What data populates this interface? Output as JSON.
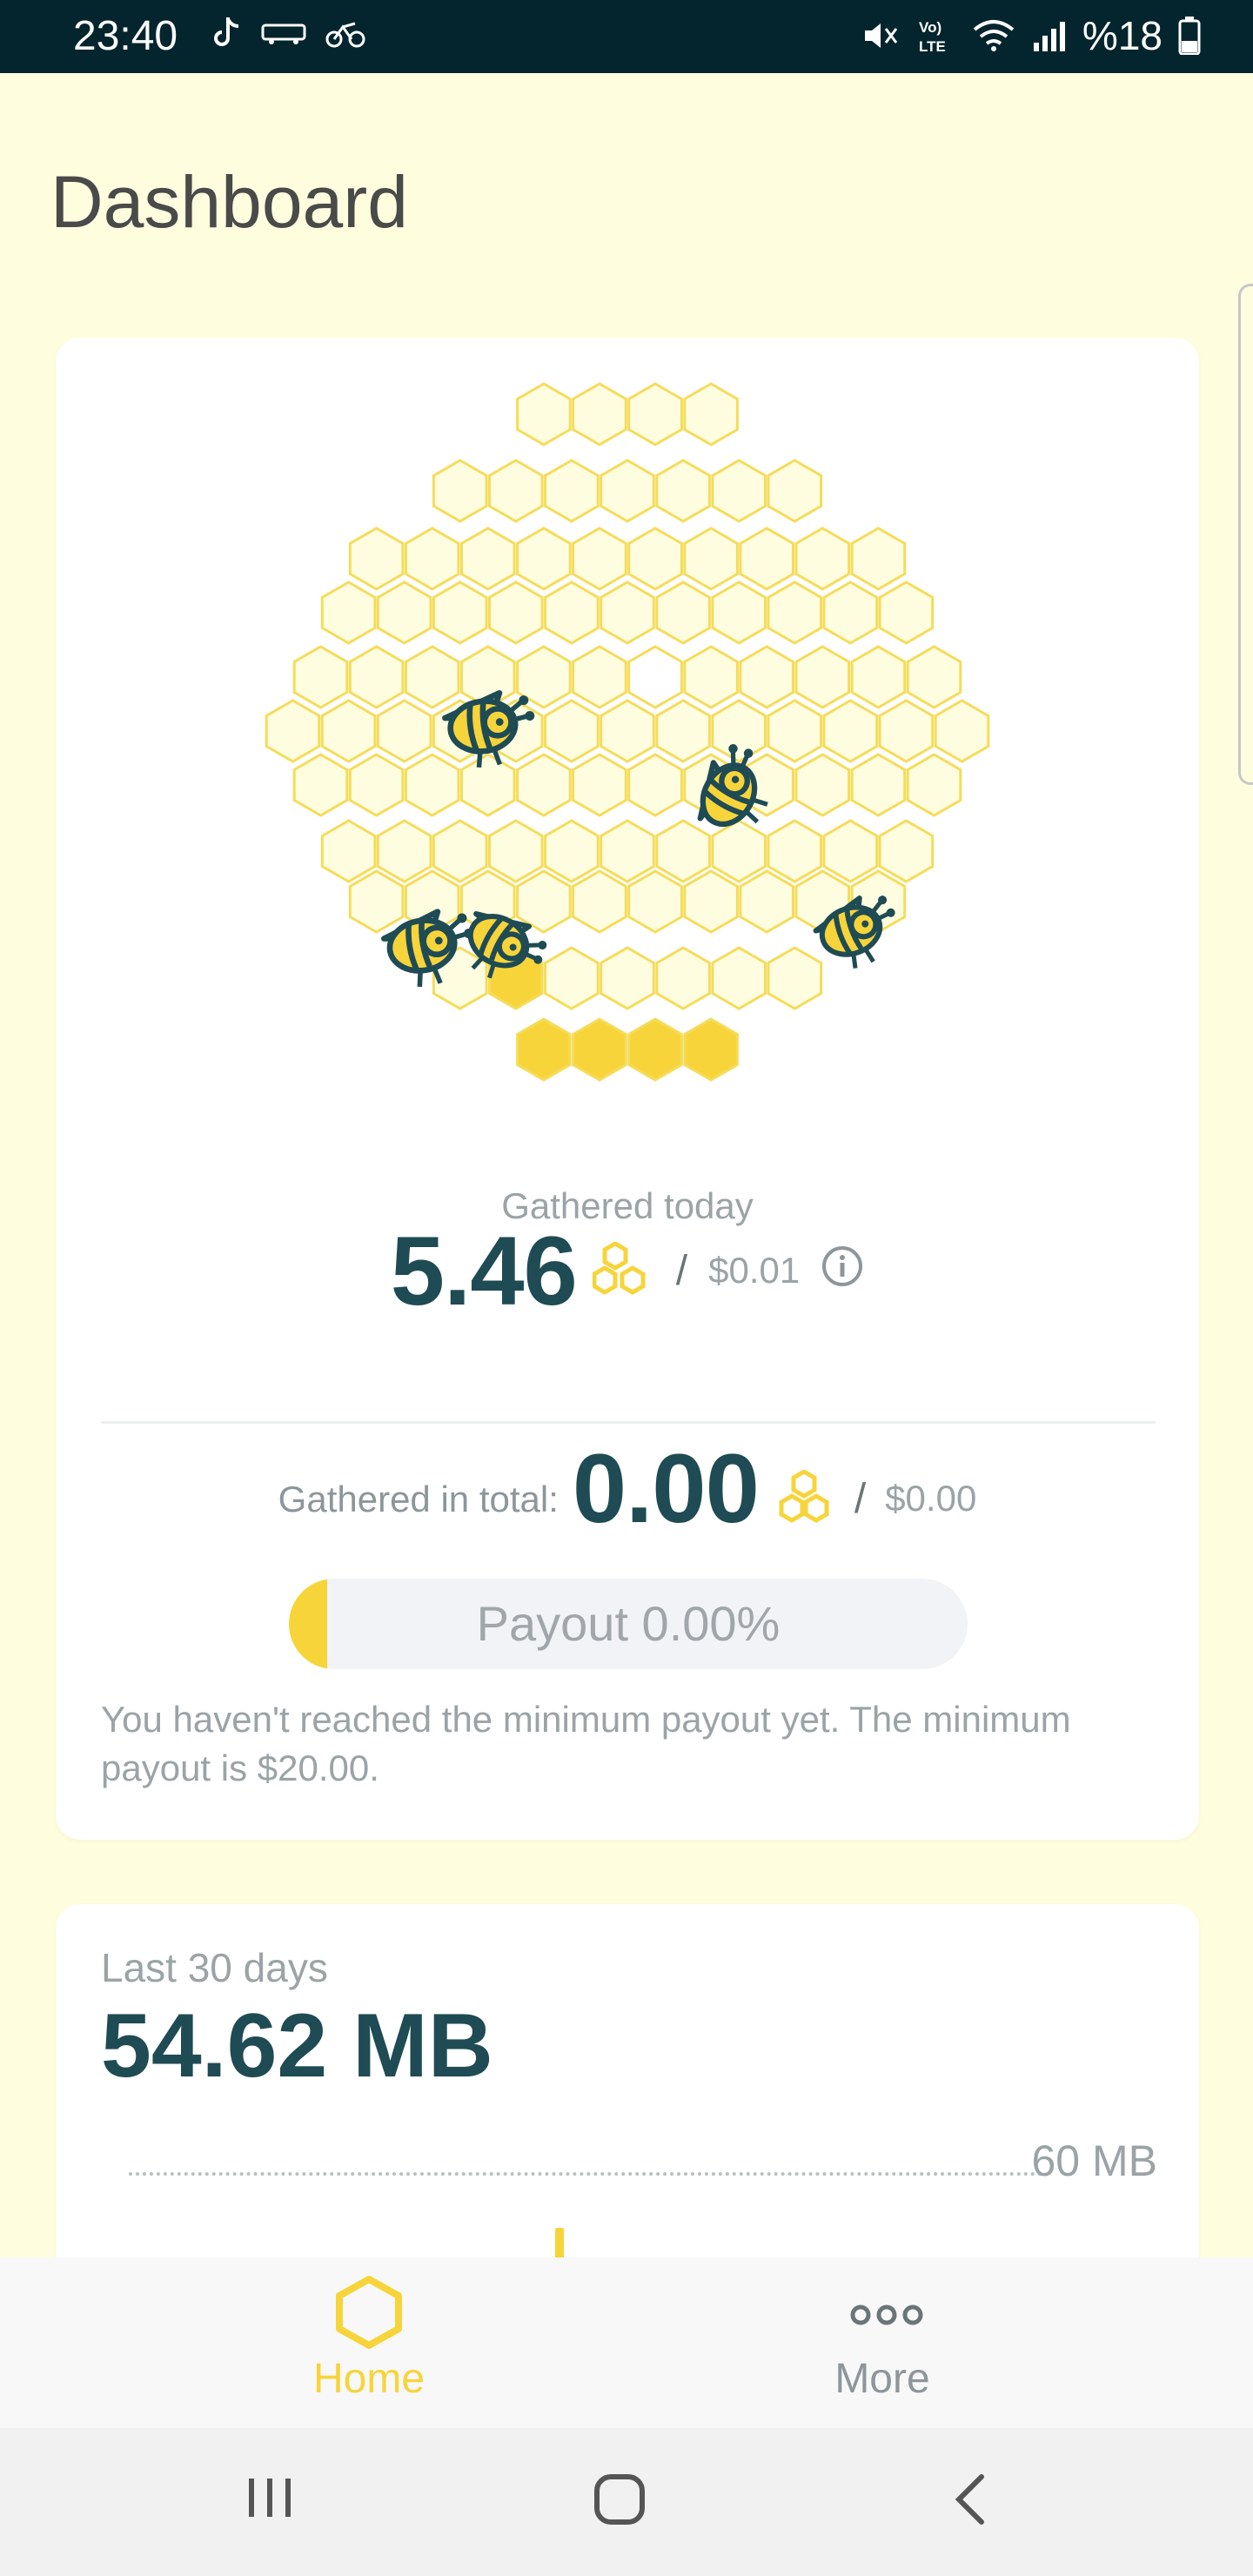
{
  "status_bar": {
    "time": "23:40",
    "battery_text": "%18",
    "left_icons": [
      "tiktok-icon",
      "bus-icon",
      "bicycle-icon"
    ],
    "right_icons": [
      "mute-icon",
      "volte-icon",
      "wifi-icon",
      "signal-icon",
      "battery-icon"
    ]
  },
  "page": {
    "title": "Dashboard"
  },
  "today": {
    "label": "Gathered today",
    "value": "5.46",
    "slash": "/",
    "usd": "$0.01",
    "info_icon": "info-icon"
  },
  "total": {
    "label": "Gathered in total:",
    "value": "0.00",
    "slash": "/",
    "usd": "$0.00"
  },
  "payout": {
    "label": "Payout 0.00%",
    "percent": 0.0,
    "note": "You haven't reached the minimum payout yet. The minimum payout is $20.00."
  },
  "stats": {
    "label": "Last 30 days",
    "value": "54.62 MB",
    "max_label": "60 MB"
  },
  "bottom_nav": {
    "home_label": "Home",
    "more_label": "More"
  },
  "colors": {
    "accent": "#f7d43a",
    "dark": "#1f4b54",
    "background": "#fefedf"
  }
}
